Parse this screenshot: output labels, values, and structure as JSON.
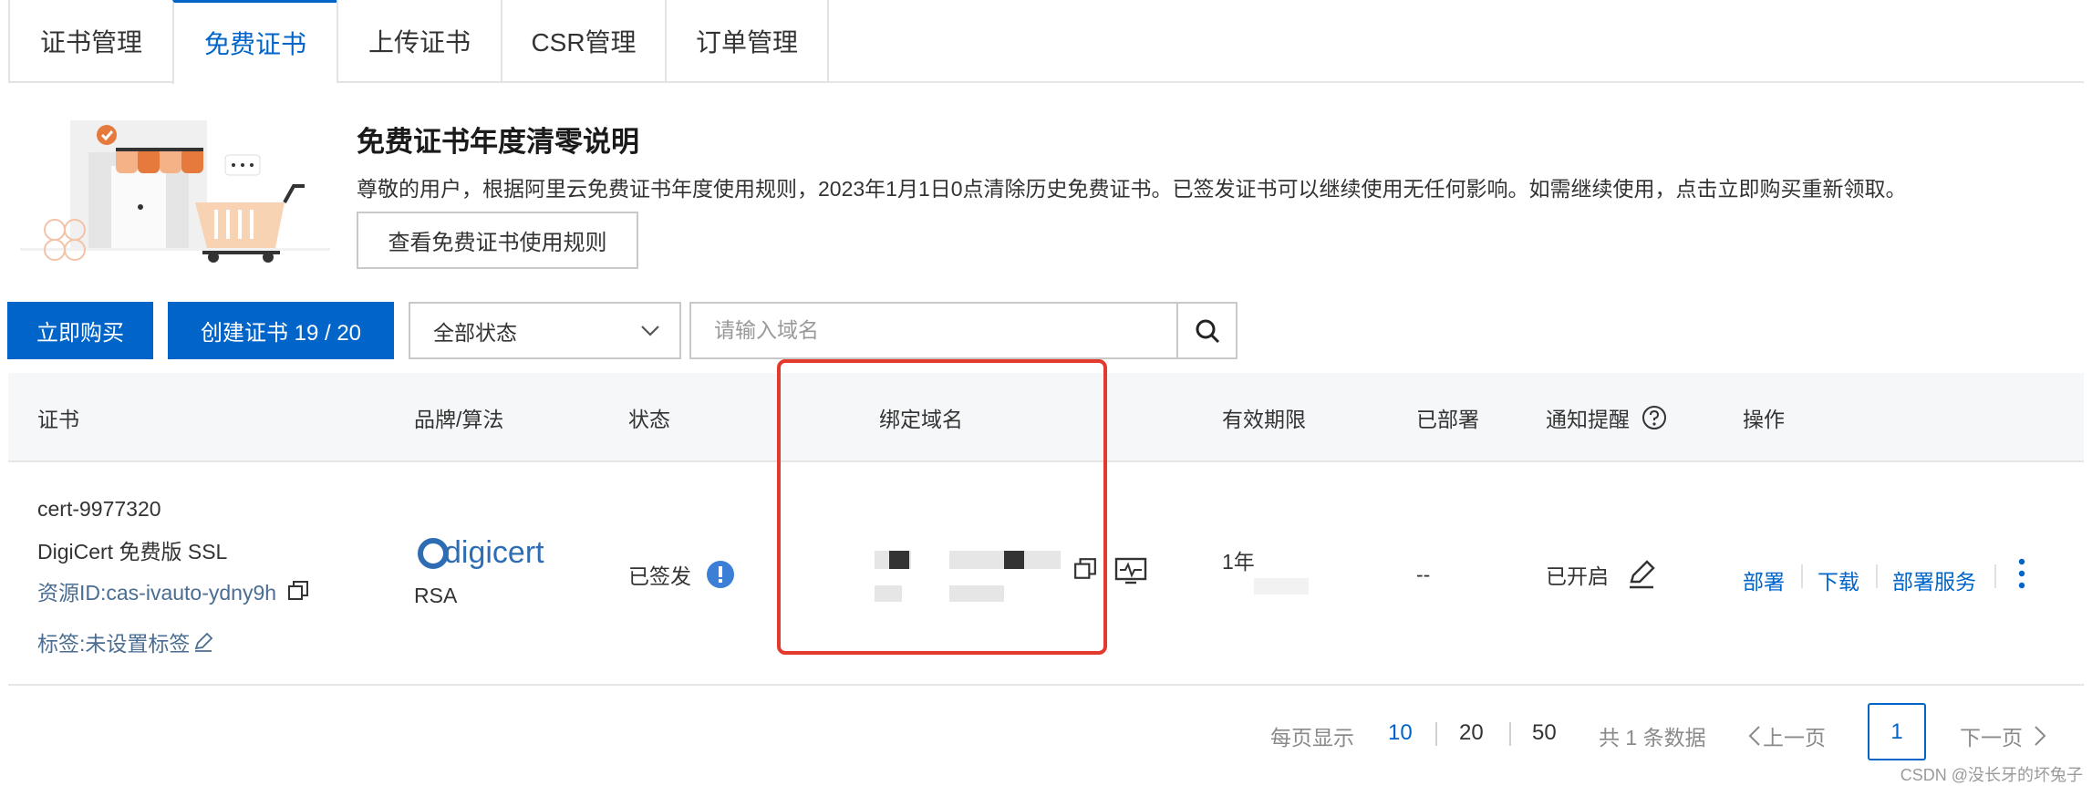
{
  "tabs": [
    {
      "label": "证书管理",
      "active": false
    },
    {
      "label": "免费证书",
      "active": true
    },
    {
      "label": "上传证书",
      "active": false
    },
    {
      "label": "CSR管理",
      "active": false
    },
    {
      "label": "订单管理",
      "active": false
    }
  ],
  "notice": {
    "title": "免费证书年度清零说明",
    "body": "尊敬的用户，根据阿里云免费证书年度使用规则，2023年1月1日0点清除历史免费证书。已签发证书可以继续使用无任何影响。如需继续使用，点击立即购买重新领取。",
    "rules_button": "查看免费证书使用规则"
  },
  "toolbar": {
    "buy_label": "立即购买",
    "create_label": "创建证书 19 / 20",
    "status_select_value": "全部状态",
    "search_placeholder": "请输入域名"
  },
  "table": {
    "headers": {
      "cert": "证书",
      "brand": "品牌/算法",
      "status": "状态",
      "domain": "绑定域名",
      "validity": "有效期限",
      "deployed": "已部署",
      "notify": "通知提醒",
      "actions": "操作"
    },
    "rows": [
      {
        "cert_name": "cert-9977320",
        "cert_type": "DigiCert 免费版 SSL",
        "resource_id": "资源ID:cas-ivauto-ydny9h",
        "tag": "标签:未设置标签",
        "brand_logo": "digicert",
        "algorithm": "RSA",
        "status": "已签发",
        "validity": "1年",
        "deployed": "--",
        "notify": "已开启",
        "actions": [
          "部署",
          "下载",
          "部署服务"
        ]
      }
    ]
  },
  "pagination": {
    "per_page_label": "每页显示",
    "sizes": [
      "10",
      "20",
      "50"
    ],
    "active_size": "10",
    "total_label": "共 1 条数据",
    "prev_label": "上一页",
    "current_page": "1",
    "next_label": "下一页"
  },
  "watermark": "CSDN @没长牙的坏兔子",
  "colors": {
    "accent": "#0064c8",
    "highlight_border": "#e23b2e",
    "header_bg": "#f6f7f8"
  },
  "icons": [
    "check-badge-icon",
    "chevron-down-icon",
    "search-icon",
    "info-icon",
    "copy-icon",
    "monitor-icon",
    "help-icon",
    "edit-icon",
    "more-vertical-icon"
  ]
}
